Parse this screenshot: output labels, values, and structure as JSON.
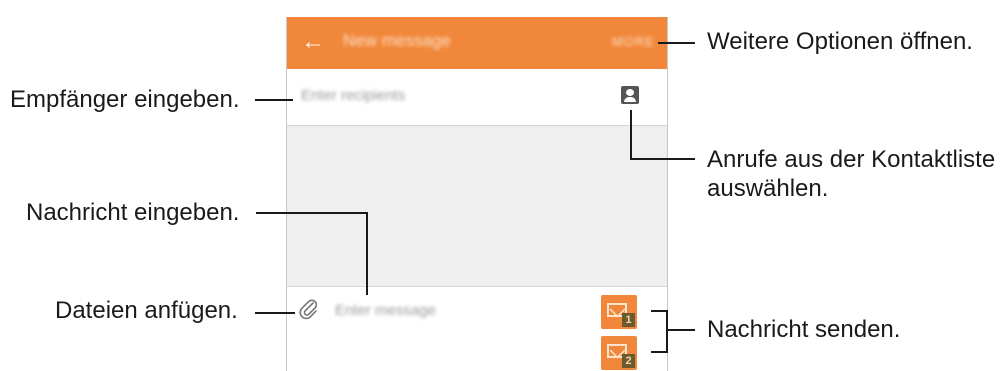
{
  "phone": {
    "app_bar": {
      "back_icon": "arrow-left-icon",
      "title": "New message",
      "more_label": "MORE"
    },
    "recipients": {
      "placeholder": "Enter recipients",
      "contact_icon": "contact-icon"
    },
    "composer": {
      "attach_icon": "paperclip-icon",
      "placeholder": "Enter message",
      "send_sim1_label": "1",
      "send_sim2_label": "2"
    }
  },
  "annotations": {
    "more_options": "Weitere Optionen öffnen.",
    "enter_recipient": "Empfänger eingeben.",
    "contacts_line1": "Anrufe aus der Kontaktliste",
    "contacts_line2": "auswählen.",
    "enter_message": "Nachricht eingeben.",
    "attach_files": "Dateien anfügen.",
    "send_message": "Nachricht senden."
  },
  "colors": {
    "app_bar": "#f1873a",
    "message_area": "#efefef",
    "send_button": "#f0873a"
  }
}
